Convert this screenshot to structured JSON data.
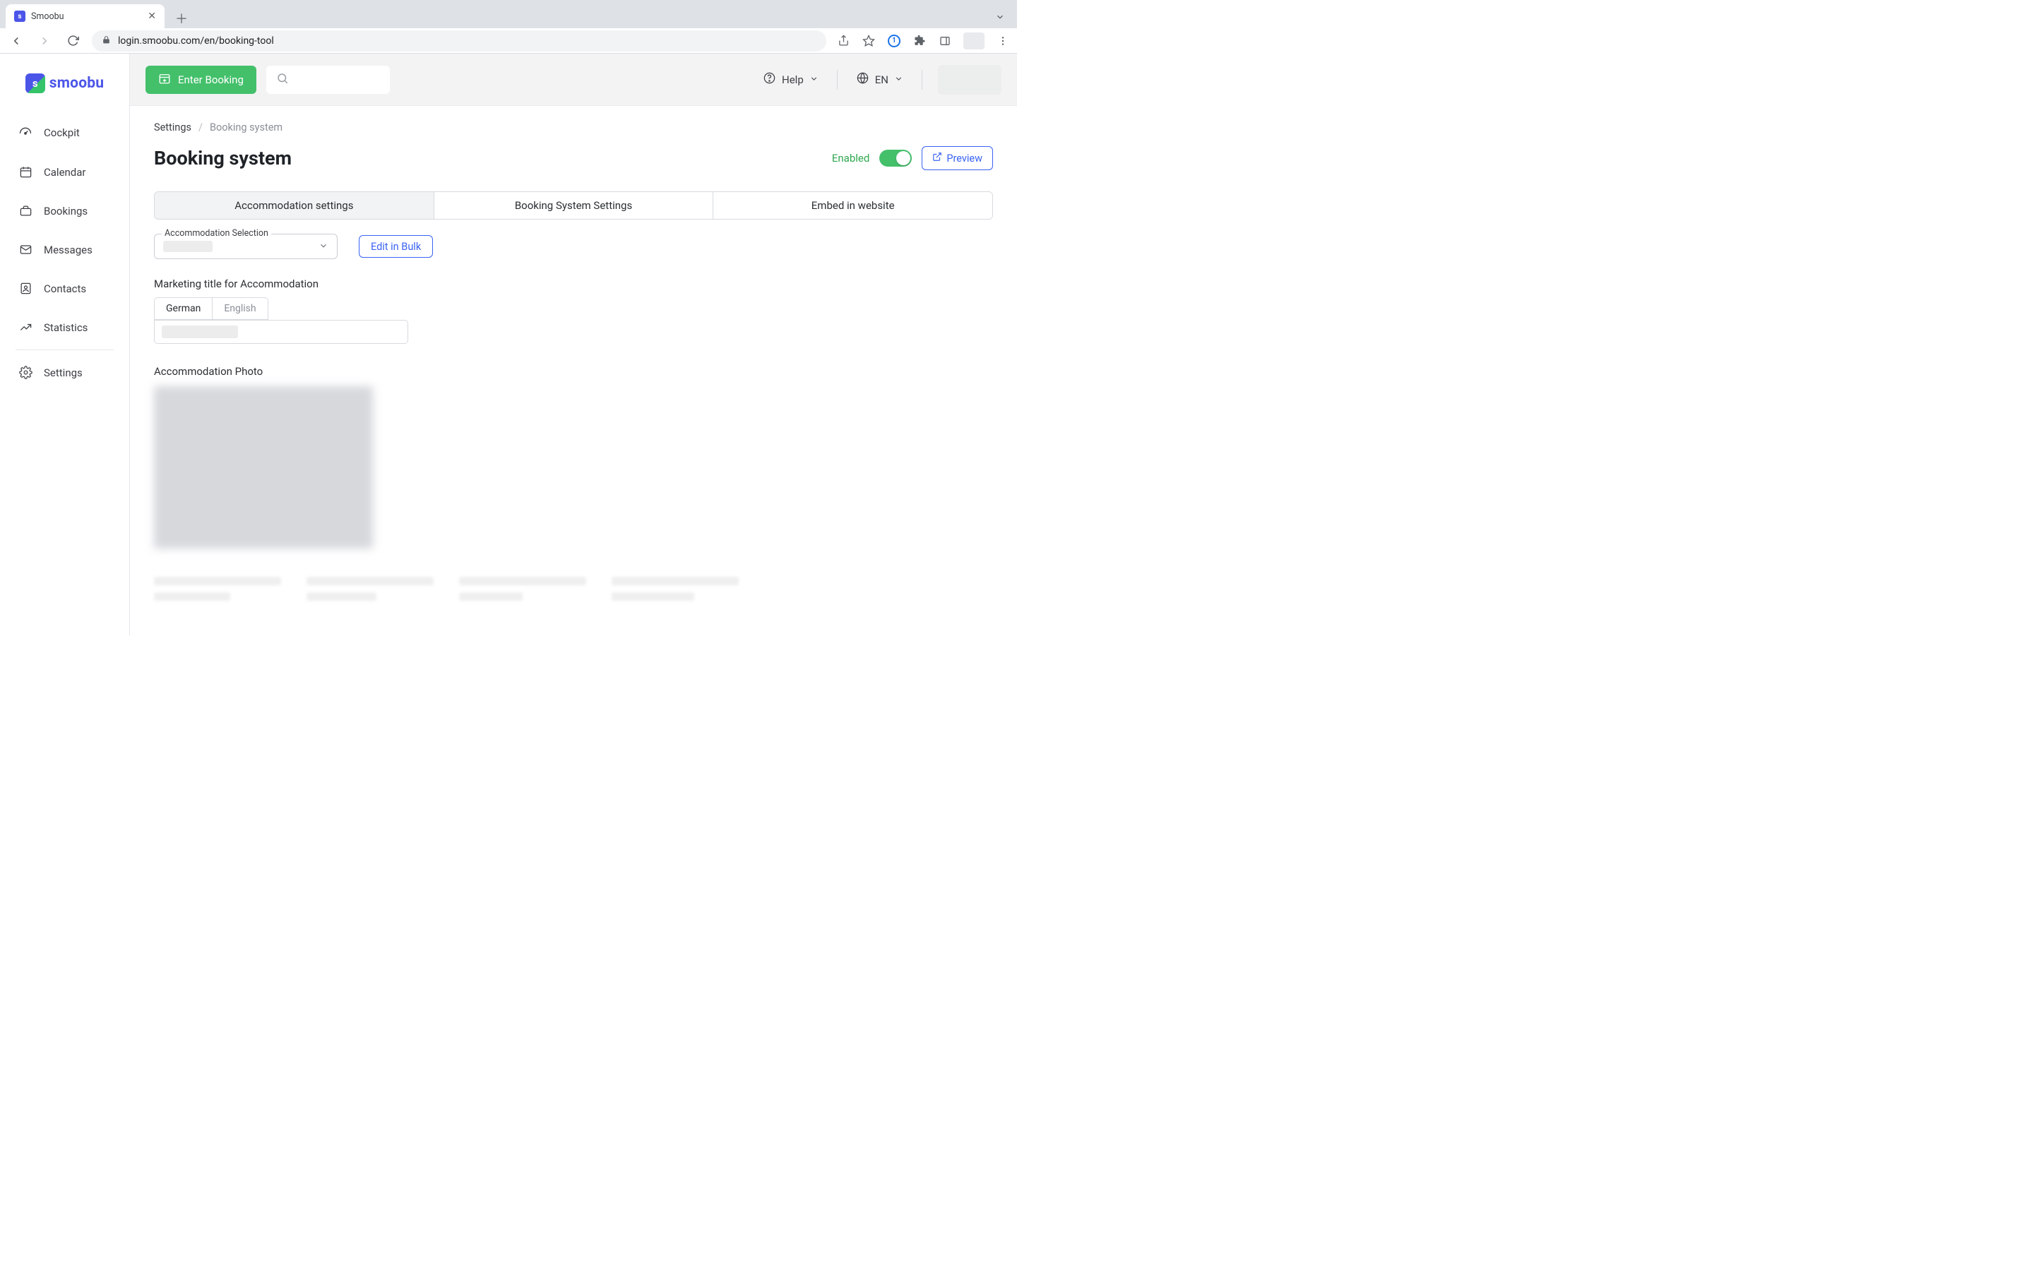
{
  "browser": {
    "tab_title": "Smoobu",
    "url": "login.smoobu.com/en/booking-tool"
  },
  "sidebar": {
    "logo_text": "smoobu",
    "items": [
      {
        "label": "Cockpit"
      },
      {
        "label": "Calendar"
      },
      {
        "label": "Bookings"
      },
      {
        "label": "Messages"
      },
      {
        "label": "Contacts"
      },
      {
        "label": "Statistics"
      },
      {
        "label": "Settings"
      }
    ]
  },
  "topbar": {
    "enter_booking_label": "Enter Booking",
    "help_label": "Help",
    "language_label": "EN"
  },
  "breadcrumb": {
    "root": "Settings",
    "sep": "/",
    "current": "Booking system"
  },
  "page": {
    "title": "Booking system",
    "enabled_label": "Enabled",
    "preview_label": "Preview"
  },
  "subtabs": [
    "Accommodation settings",
    "Booking System Settings",
    "Embed in website"
  ],
  "form": {
    "accommodation_selection_label": "Accommodation Selection",
    "edit_in_bulk_label": "Edit in Bulk",
    "marketing_title_label": "Marketing title for Accommodation",
    "lang_tab_german": "German",
    "lang_tab_english": "English",
    "accommodation_photo_label": "Accommodation Photo"
  }
}
